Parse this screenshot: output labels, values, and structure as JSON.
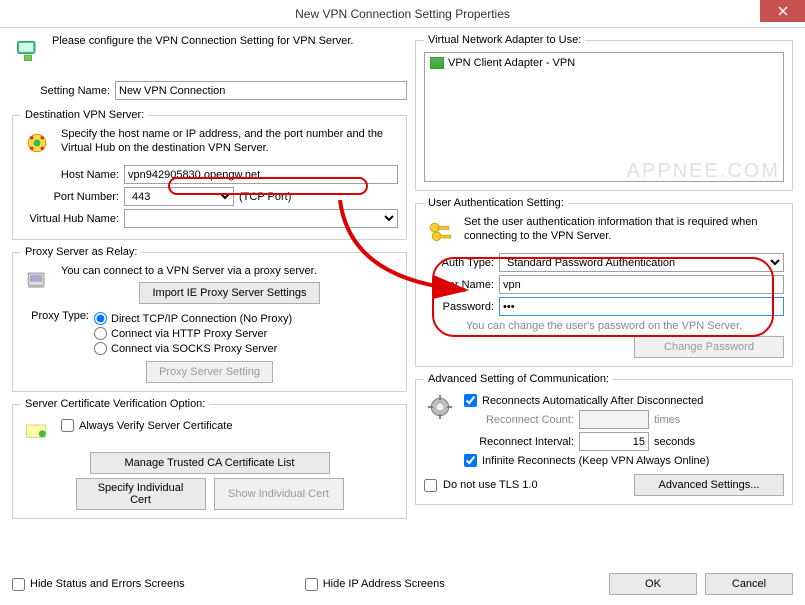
{
  "window": {
    "title": "New VPN Connection Setting Properties"
  },
  "intro": {
    "text": "Please configure the VPN Connection Setting for VPN Server.",
    "setting_name_label": "Setting Name:",
    "setting_name_value": "New VPN Connection"
  },
  "dest": {
    "legend": "Destination VPN Server:",
    "desc": "Specify the host name or IP address, and the port number and the Virtual Hub on the destination VPN Server.",
    "host_label": "Host Name:",
    "host_value": "vpn942905830.opengw.net",
    "port_label": "Port Number:",
    "port_value": "443",
    "tcp_port": "(TCP Port)",
    "vhub_label": "Virtual Hub Name:",
    "vhub_value": ""
  },
  "proxy": {
    "legend": "Proxy Server as Relay:",
    "desc": "You can connect to a VPN Server via a proxy server.",
    "import_btn": "Import IE Proxy Server Settings",
    "type_label": "Proxy Type:",
    "opt_direct": "Direct TCP/IP Connection (No Proxy)",
    "opt_http": "Connect via HTTP Proxy Server",
    "opt_socks": "Connect via SOCKS Proxy Server",
    "setting_btn": "Proxy Server Setting"
  },
  "cert": {
    "legend": "Server Certificate Verification Option:",
    "always_verify": "Always Verify Server Certificate",
    "manage_btn": "Manage Trusted CA Certificate List",
    "specify_btn": "Specify Individual Cert",
    "show_btn": "Show Individual Cert"
  },
  "adapter": {
    "legend": "Virtual Network Adapter to Use:",
    "item": "VPN Client Adapter - VPN"
  },
  "auth": {
    "legend": "User Authentication Setting:",
    "desc": "Set the user authentication information that is required when connecting to the VPN Server.",
    "type_label": "Auth Type:",
    "type_value": "Standard Password Authentication",
    "user_label": "User Name:",
    "user_value": "vpn",
    "pass_label": "Password:",
    "pass_value": "•••",
    "hint": "You can change the user's password on the VPN Server.",
    "change_btn": "Change Password"
  },
  "adv": {
    "legend": "Advanced Setting of Communication:",
    "reconnect_auto": "Reconnects Automatically After Disconnected",
    "count_label": "Reconnect Count:",
    "count_value": "",
    "count_unit": "times",
    "interval_label": "Reconnect Interval:",
    "interval_value": "15",
    "interval_unit": "seconds",
    "infinite": "Infinite Reconnects (Keep VPN Always Online)",
    "no_tls": "Do not use TLS 1.0",
    "advanced_btn": "Advanced Settings..."
  },
  "footer": {
    "hide_status": "Hide Status and Errors Screens",
    "hide_ip": "Hide IP Address Screens",
    "ok": "OK",
    "cancel": "Cancel"
  },
  "watermark": "APPNEE.COM"
}
